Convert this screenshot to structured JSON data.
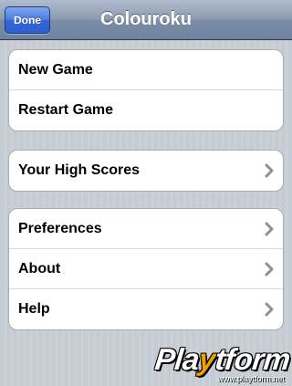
{
  "navbar": {
    "title": "Colouroku",
    "done_label": "Done"
  },
  "menu": {
    "group1": [
      {
        "label": "New Game",
        "chevron": false
      },
      {
        "label": "Restart Game",
        "chevron": false
      }
    ],
    "group2": [
      {
        "label": "Your High Scores",
        "chevron": true
      }
    ],
    "group3": [
      {
        "label": "Preferences",
        "chevron": true
      },
      {
        "label": "About",
        "chevron": true
      },
      {
        "label": "Help",
        "chevron": true
      }
    ]
  },
  "watermark": {
    "logo_before": "Pla",
    "logo_accent": "y",
    "logo_after": "tform",
    "url": "www.playtform.net"
  },
  "icons": {
    "disclosure": "chevron-right-icon"
  },
  "colors": {
    "done_button": "#3366d6",
    "navbar": "#6d83a1",
    "background": "#c5ccd4",
    "chevron": "#8e8e93",
    "watermark_accent": "#f0a000"
  }
}
